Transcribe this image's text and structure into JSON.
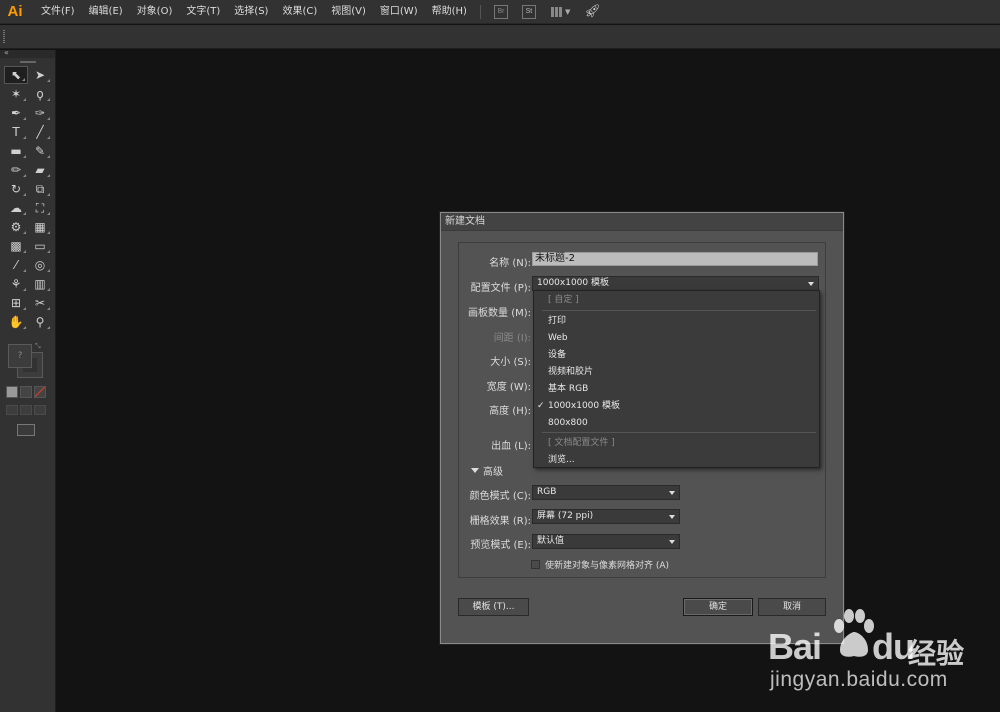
{
  "app": {
    "logo": "Ai"
  },
  "menu": [
    "文件(F)",
    "编辑(E)",
    "对象(O)",
    "文字(T)",
    "选择(S)",
    "效果(C)",
    "视图(V)",
    "窗口(W)",
    "帮助(H)"
  ],
  "menubar_buttons": {
    "bridge": "Br",
    "stock": "St"
  },
  "tools": [
    {
      "icon": "selection-tool-icon",
      "glyph": "⬉",
      "selected": true
    },
    {
      "icon": "direct-selection-tool-icon",
      "glyph": "➤"
    },
    {
      "icon": "magic-wand-tool-icon",
      "glyph": "✶"
    },
    {
      "icon": "lasso-tool-icon",
      "glyph": "ϙ"
    },
    {
      "icon": "pen-tool-icon",
      "glyph": "✒"
    },
    {
      "icon": "curvature-tool-icon",
      "glyph": "✑"
    },
    {
      "icon": "type-tool-icon",
      "glyph": "T"
    },
    {
      "icon": "line-tool-icon",
      "glyph": "╱"
    },
    {
      "icon": "rectangle-tool-icon",
      "glyph": "▬"
    },
    {
      "icon": "paintbrush-tool-icon",
      "glyph": "✎"
    },
    {
      "icon": "pencil-tool-icon",
      "glyph": "✏"
    },
    {
      "icon": "eraser-tool-icon",
      "glyph": "▰"
    },
    {
      "icon": "rotate-tool-icon",
      "glyph": "↻"
    },
    {
      "icon": "scale-tool-icon",
      "glyph": "⧉"
    },
    {
      "icon": "warp-tool-icon",
      "glyph": "☁"
    },
    {
      "icon": "free-transform-tool-icon",
      "glyph": "⛶"
    },
    {
      "icon": "shape-builder-tool-icon",
      "glyph": "⚙"
    },
    {
      "icon": "perspective-grid-tool-icon",
      "glyph": "▦"
    },
    {
      "icon": "mesh-tool-icon",
      "glyph": "▩"
    },
    {
      "icon": "gradient-tool-icon",
      "glyph": "▭"
    },
    {
      "icon": "eyedropper-tool-icon",
      "glyph": "⁄"
    },
    {
      "icon": "blend-tool-icon",
      "glyph": "◎"
    },
    {
      "icon": "symbol-sprayer-tool-icon",
      "glyph": "⚘"
    },
    {
      "icon": "column-graph-tool-icon",
      "glyph": "▥"
    },
    {
      "icon": "artboard-tool-icon",
      "glyph": "⊞"
    },
    {
      "icon": "slice-tool-icon",
      "glyph": "✂"
    },
    {
      "icon": "hand-tool-icon",
      "glyph": "✋"
    },
    {
      "icon": "zoom-tool-icon",
      "glyph": "⚲"
    }
  ],
  "fill_stroke": {
    "fill_glyph": "?"
  },
  "dialog": {
    "title": "新建文档",
    "name_label": "名称 (N):",
    "name_value": "未标题-2",
    "profile_label": "配置文件 (P):",
    "profile_value": "1000x1000 模板",
    "artboards_label": "画板数量 (M):",
    "spacing_label": "间距 (I):",
    "size_label": "大小 (S):",
    "width_label": "宽度 (W):",
    "height_label": "高度 (H):",
    "bleed_label": "出血 (L):",
    "advanced_label": "高级",
    "color_mode_label": "颜色模式 (C):",
    "color_mode_value": "RGB",
    "raster_label": "栅格效果 (R):",
    "raster_value": "屏幕 (72 ppi)",
    "preview_label": "预览模式 (E):",
    "preview_value": "默认值",
    "align_pixel_label": "使新建对象与像素网格对齐 (A)",
    "align_pixel_checked": false,
    "templates_button": "模板 (T)...",
    "ok_button": "确定",
    "cancel_button": "取消"
  },
  "profile_dropdown": {
    "items": [
      {
        "label": "[ 自定 ]",
        "disabled": true,
        "checked": false
      },
      {
        "label": "打印",
        "disabled": false,
        "checked": false
      },
      {
        "label": "Web",
        "disabled": false,
        "checked": false
      },
      {
        "label": "设备",
        "disabled": false,
        "checked": false
      },
      {
        "label": "视频和胶片",
        "disabled": false,
        "checked": false
      },
      {
        "label": "基本 RGB",
        "disabled": false,
        "checked": false
      },
      {
        "label": "1000x1000 模板",
        "disabled": false,
        "checked": true
      },
      {
        "label": "800x800",
        "disabled": false,
        "checked": false
      },
      {
        "label": "[ 文档配置文件 ]",
        "disabled": true,
        "checked": false
      },
      {
        "label": "浏览...",
        "disabled": false,
        "checked": false
      }
    ],
    "check_glyph": "✓"
  },
  "watermark": {
    "bai": "Bai",
    "du": "du",
    "jingyan": "经验",
    "url": "jingyan.baidu.com"
  }
}
